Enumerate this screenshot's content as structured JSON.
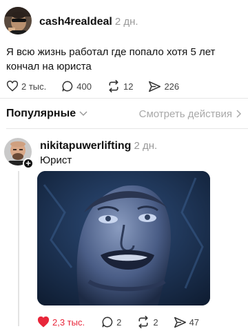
{
  "post": {
    "username": "cash4realdeal",
    "time": "2 дн.",
    "text": "Я всю жизнь работал где попало хотя 5 лет кончал на юриста",
    "likes": "2 тыс.",
    "comments": "400",
    "reposts": "12",
    "shares": "226"
  },
  "sort_bar": {
    "sort_label": "Популярные",
    "activity_link": "Смотреть действия"
  },
  "reply": {
    "username": "nikitapuwerlifting",
    "time": "2 дн.",
    "text": "Юрист",
    "likes": "2,3 тыс.",
    "comments": "2",
    "reposts": "2",
    "shares": "47",
    "liked_color": "#e8263a"
  },
  "icons": {
    "like": "heart-icon",
    "comment": "speech-bubble-icon",
    "repost": "repost-arrows-icon",
    "share": "send-arrow-icon",
    "sort": "chevron-down-icon",
    "activity": "chevron-right-icon",
    "follow": "plus-icon"
  }
}
